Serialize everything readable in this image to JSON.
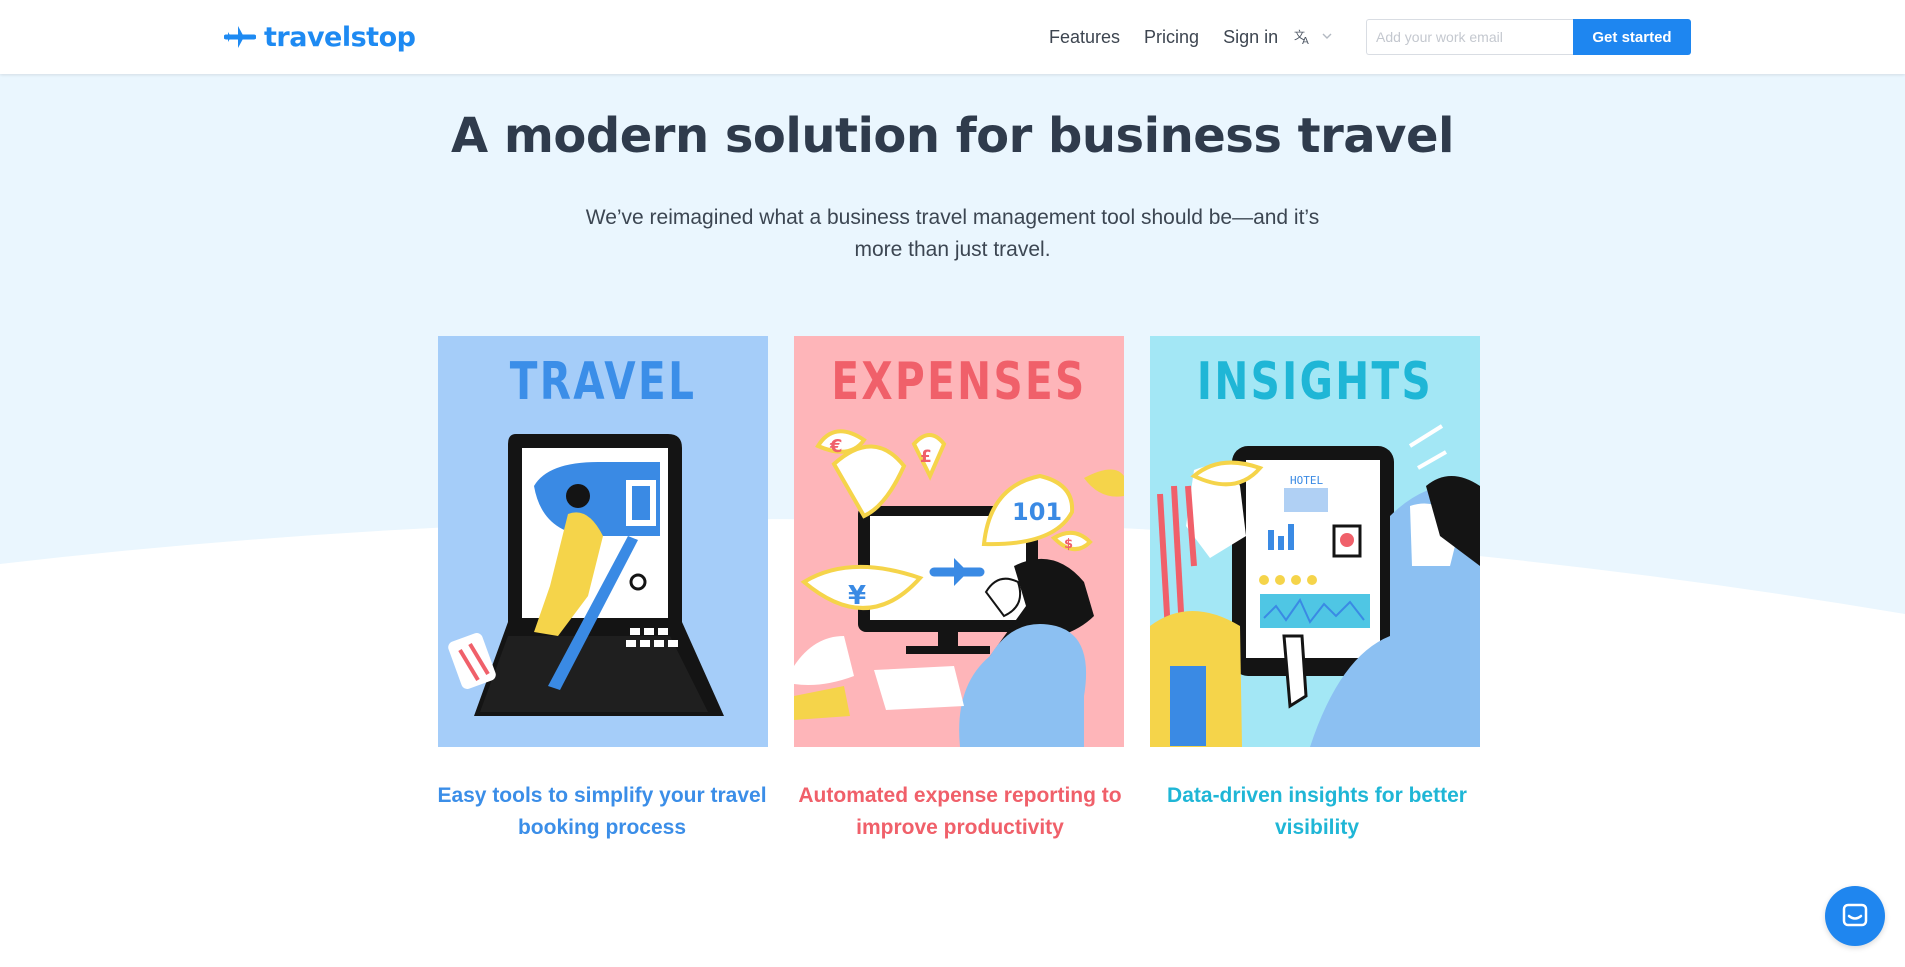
{
  "header": {
    "logo_text": "travelstop",
    "logo_icon": "plane-icon",
    "nav": [
      "Features",
      "Pricing",
      "Sign in"
    ],
    "language_icon": "translate-icon",
    "email_placeholder": "Add your work email",
    "email_value": "",
    "cta_label": "Get started"
  },
  "hero": {
    "title": "A modern solution for business travel",
    "subtitle": "We’ve reimagined what a business travel management tool should be—and it’s more than just travel."
  },
  "cards": [
    {
      "title": "TRAVEL",
      "caption": "Easy tools to simplify your travel booking process",
      "color": "#3b8ee8",
      "bg": "#a5cdf9"
    },
    {
      "title": "EXPENSES",
      "caption": "Automated expense reporting to improve productivity",
      "color": "#f0606a",
      "bg": "#feb5b9"
    },
    {
      "title": "INSIGHTS",
      "caption": "Data-driven insights for better visibility",
      "color": "#1fb6d6",
      "bg": "#a3e7f5"
    }
  ],
  "colors": {
    "brand": "#1e86f0",
    "hero_bg": "#eaf6fe",
    "text": "#2f3b4c"
  },
  "chat_icon": "chat-icon"
}
